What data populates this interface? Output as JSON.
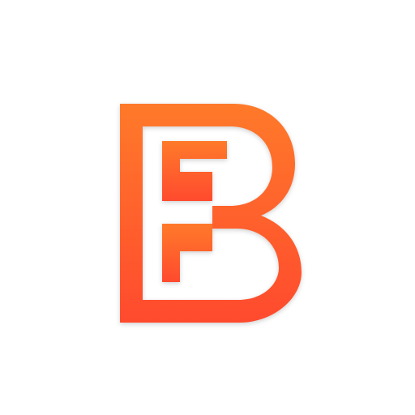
{
  "logo": {
    "name": "letter-b-logo",
    "gradient_top": "#FF7A2A",
    "gradient_bottom": "#FF4A2E"
  },
  "background": "#FFFFFF"
}
